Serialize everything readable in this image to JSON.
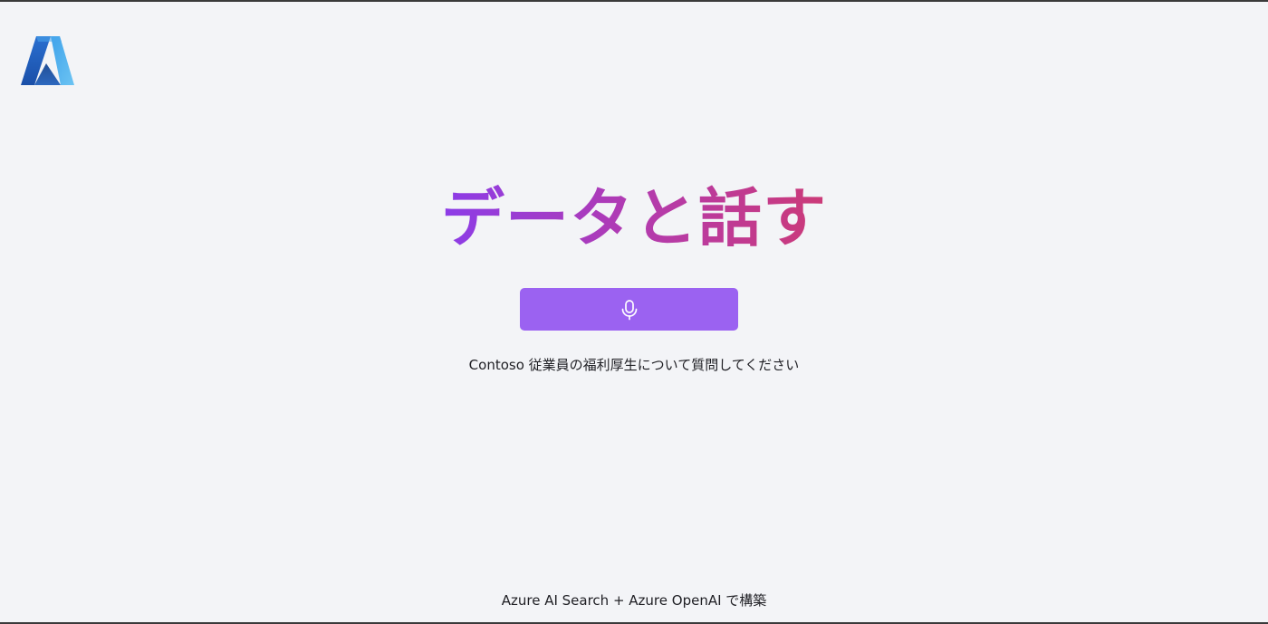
{
  "header": {
    "logo_icon": "azure-logo-icon"
  },
  "main": {
    "title": "データと話す",
    "mic_button_icon": "microphone-icon",
    "subtitle": "Contoso 従業員の福利厚生について質問してください"
  },
  "footer": {
    "text": "Azure AI Search + Azure OpenAI で構築"
  },
  "colors": {
    "background": "#f3f4f7",
    "title_gradient_start": "#8c3ce8",
    "title_gradient_end": "#cc3a77",
    "mic_button": "#9b62f1",
    "logo_dark": "#1f5fbf",
    "logo_light": "#5ab7ee"
  }
}
